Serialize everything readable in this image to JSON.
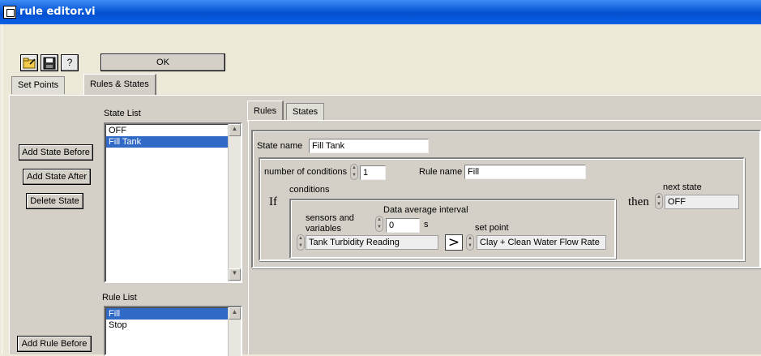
{
  "window": {
    "title": "rule editor.vi"
  },
  "toolbar": {
    "open_icon": "open-folder-icon",
    "save_icon": "save-disk-icon",
    "help_icon": "help-question-icon",
    "help_glyph": "?",
    "ok_label": "OK"
  },
  "main_tabs": [
    {
      "label": "Set Points"
    },
    {
      "label": "Rules & States"
    }
  ],
  "state_buttons": {
    "add_before": "Add State Before",
    "add_after": "Add State After",
    "delete": "Delete State"
  },
  "state_list": {
    "label": "State List",
    "items": [
      "OFF",
      "Fill Tank"
    ],
    "selected": "Fill Tank"
  },
  "rule_list": {
    "label": "Rule List",
    "items": [
      "Fill",
      "Stop"
    ],
    "selected": "Fill"
  },
  "rule_buttons": {
    "add_before": "Add Rule Before"
  },
  "sub_tabs": [
    {
      "label": "Rules"
    },
    {
      "label": "States"
    }
  ],
  "rules_editor": {
    "state_name_label": "State name",
    "state_name": "Fill Tank",
    "num_conditions_label": "number of conditions",
    "num_conditions": "1",
    "rule_name_label": "Rule name",
    "rule_name": "Fill",
    "if_label": "If",
    "conditions_label": "conditions",
    "sensors_label": "sensors and variables",
    "sensor_value": "Tank Turbidity Reading",
    "data_avg_label": "Data average interval",
    "data_avg_value": "0",
    "data_avg_unit": "s",
    "comparator": ">",
    "set_point_label": "set point",
    "set_point_value": "Clay + Clean Water Flow Rate",
    "then_label": "then",
    "next_state_label": "next state",
    "next_state_value": "OFF"
  },
  "colors": {
    "titlebar": "#0a5ad8",
    "selection": "#3169c6",
    "panel": "#d4d0c8"
  }
}
